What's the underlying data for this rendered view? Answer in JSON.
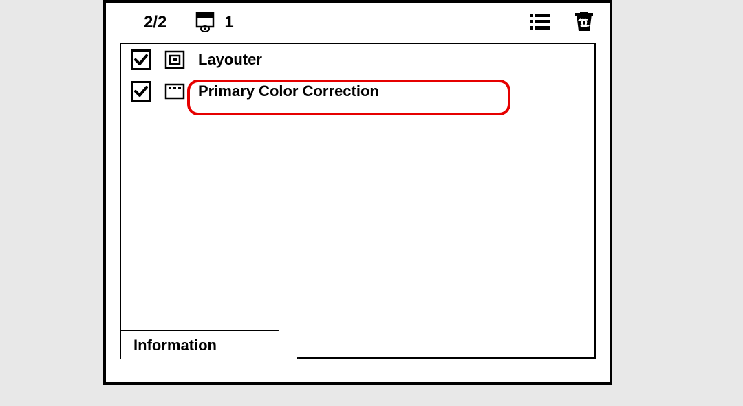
{
  "toolbar": {
    "counter": "2/2",
    "view_number": "1"
  },
  "effects": [
    {
      "checked": true,
      "label": "Layouter"
    },
    {
      "checked": true,
      "label": "Primary Color Correction"
    }
  ],
  "tab_label": "Information"
}
